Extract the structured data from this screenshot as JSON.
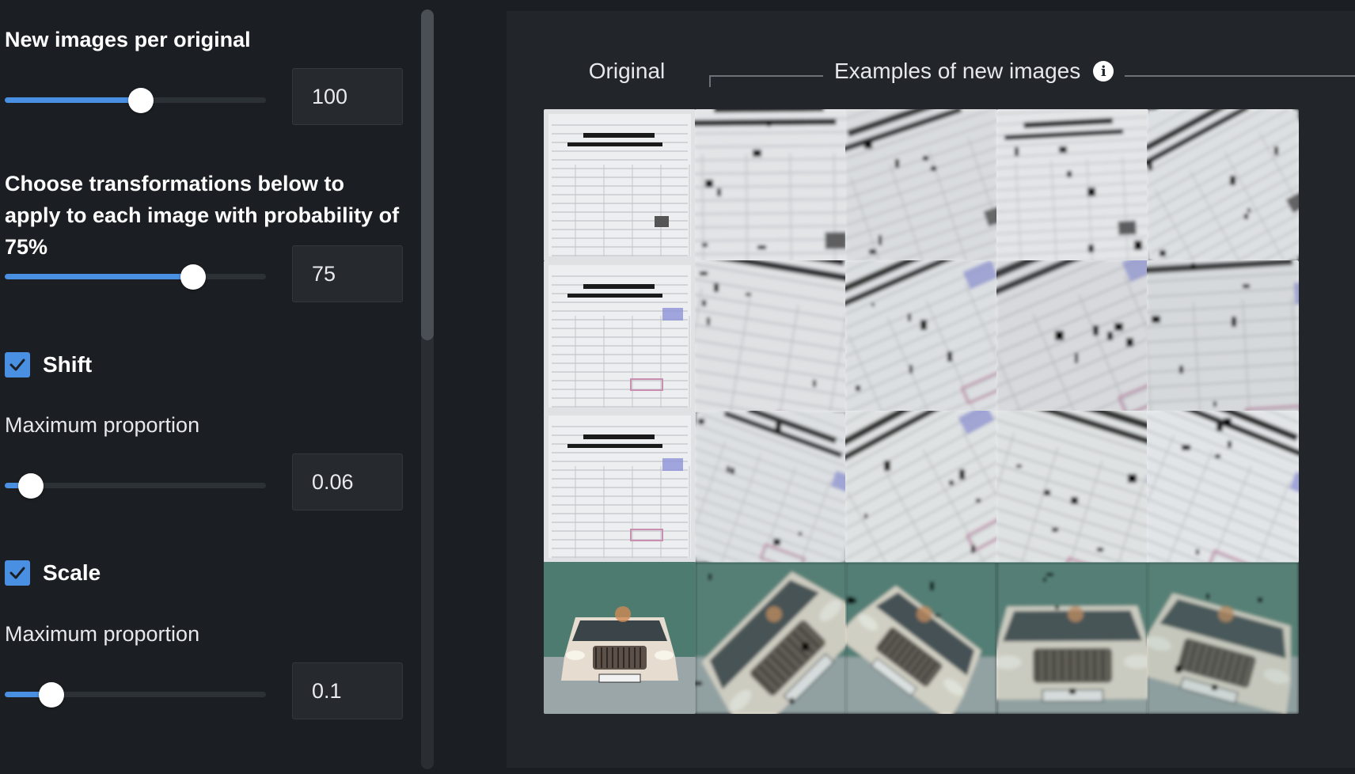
{
  "settings": {
    "new_images": {
      "label": "New images per original",
      "value": "100",
      "fraction": 0.52
    },
    "probability": {
      "label": "Choose transformations below to apply to each image with probability of 75%",
      "value": "75",
      "fraction": 0.72
    },
    "shift": {
      "label": "Shift",
      "checked": true,
      "sub_label": "Maximum proportion",
      "value": "0.06",
      "fraction": 0.1
    },
    "scale": {
      "label": "Scale",
      "checked": true,
      "sub_label": "Maximum proportion",
      "value": "0.1",
      "fraction": 0.18
    }
  },
  "preview": {
    "original_label": "Original",
    "examples_label": "Examples of new images",
    "info_icon": "info-icon",
    "rows": [
      {
        "kind": "document",
        "images": [
          "original",
          "augmented",
          "augmented",
          "augmented",
          "augmented"
        ]
      },
      {
        "kind": "document-stamped",
        "images": [
          "original",
          "augmented",
          "augmented",
          "augmented",
          "augmented"
        ]
      },
      {
        "kind": "document-stamped",
        "images": [
          "original",
          "augmented",
          "augmented",
          "augmented",
          "augmented"
        ]
      },
      {
        "kind": "car",
        "images": [
          "original",
          "augmented",
          "augmented",
          "augmented",
          "augmented"
        ]
      }
    ]
  },
  "colors": {
    "accent": "#4a90e2",
    "panel": "#22262b",
    "background": "#1b1e22"
  }
}
